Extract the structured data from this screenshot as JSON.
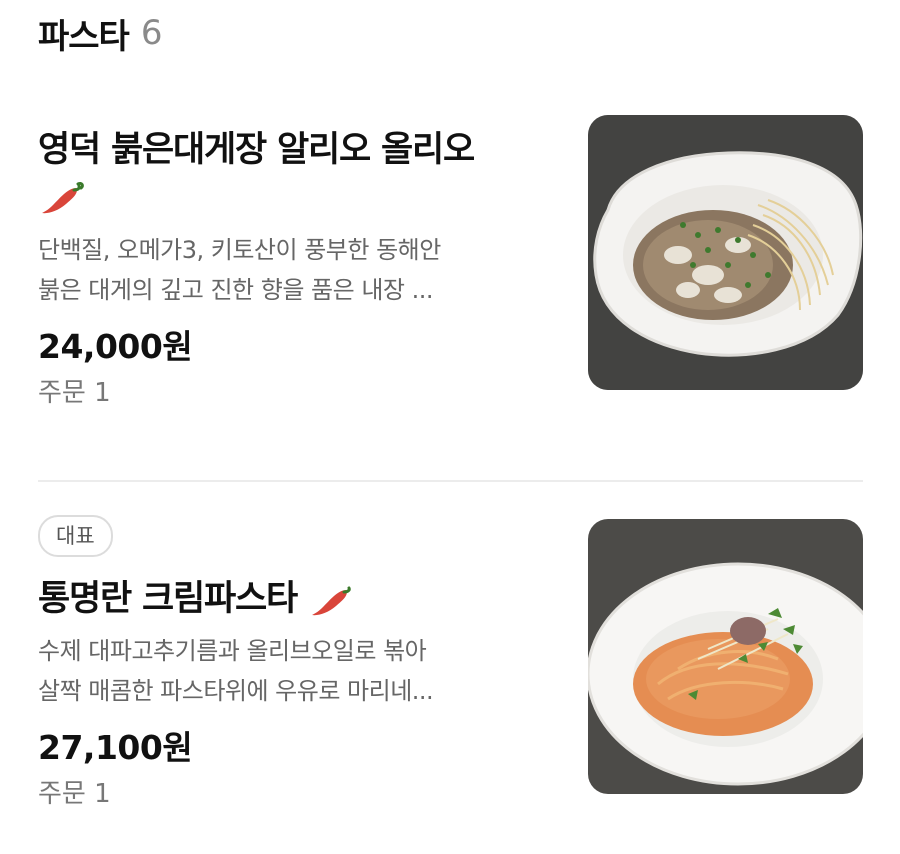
{
  "section": {
    "title": "파스타",
    "count": "6"
  },
  "items": [
    {
      "name": "영덕 붉은대게장 알리오 올리오",
      "spicy_icon": "chili-pepper-icon",
      "description_line1": "단백질, 오메가3, 키토산이 풍부한 동해안",
      "description_line2": "붉은 대게의 깊고 진한 향을 품은 내장 ...",
      "price": "24,000원",
      "orders": "주문 1",
      "image_icon": "pasta-photo"
    },
    {
      "badge": "대표",
      "name": "통명란 크림파스타",
      "spicy_icon": "chili-pepper-icon",
      "description_line1": "수제 대파고추기름과 올리브오일로 볶아",
      "description_line2": "살짝 매콤한 파스타위에 우유로 마리네...",
      "price": "27,100원",
      "orders": "주문 1",
      "image_icon": "pasta-photo"
    }
  ],
  "colors": {
    "text_primary": "#111111",
    "text_secondary": "#666666",
    "count_gray": "#8a8a8a",
    "pepper_red": "#d9453a",
    "divider": "#ececec"
  }
}
